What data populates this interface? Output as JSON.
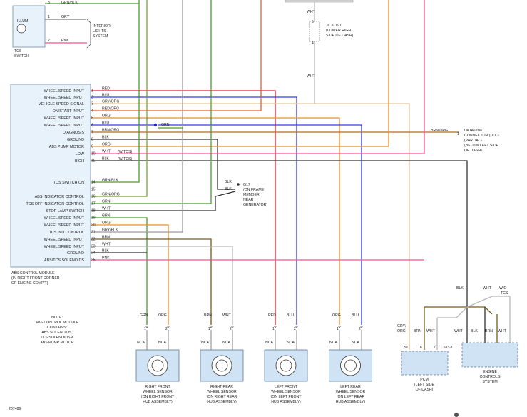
{
  "tcs_switch": {
    "illum": "ILLUM",
    "name": [
      "TCS",
      "SWITCH"
    ],
    "pins": [
      "1",
      "2"
    ],
    "wires": [
      "GRY",
      "PNK"
    ],
    "top_wire": "GRN/BLK",
    "top_pin": "3"
  },
  "interior_lights": [
    "INTERIOR",
    "LIGHTS",
    "SYSTEM"
  ],
  "jc191": {
    "wire_top": "WHT",
    "wire_bottom": "WHT",
    "label": [
      "J/C C191",
      "(LOWER RIGHT",
      "SIDE OF DASH)"
    ],
    "pins": [
      "5",
      "4"
    ]
  },
  "abs_module": {
    "title": [
      "ABS CONTROL MODULE",
      "(IN RIGHT FRONT CORNER",
      "OF ENGINE COMP'T)"
    ],
    "pins": [
      {
        "num": "1",
        "label": "WHEEL SPEED INPUT",
        "wire": "RED"
      },
      {
        "num": "2",
        "label": "WHEEL SPEED INPUT",
        "wire": "BLU"
      },
      {
        "num": "3",
        "label": "VEHICLE SPEED SIGNAL",
        "wire": "GRY/ORG"
      },
      {
        "num": "4",
        "label": "ON/START INPUT",
        "wire": "RED/ORG"
      },
      {
        "num": "5",
        "label": "WHEEL SPEED INPUT",
        "wire": "ORG"
      },
      {
        "num": "6",
        "label": "WHEEL SPEED INPUT",
        "wire": "BLU"
      },
      {
        "num": "7",
        "label": "DIAGNOSIS",
        "wire": "BRN/ORG"
      },
      {
        "num": "8",
        "label": "GROUND",
        "wire": "BLK"
      },
      {
        "num": "9",
        "label": "ABS PUMP MOTOR",
        "wire": "ORG"
      },
      {
        "num": "10",
        "label": "LOW",
        "wire": "WHT"
      },
      {
        "num": "11",
        "label": "HIGH",
        "wire": "BLK"
      },
      {
        "num": "14",
        "label": "TCS SWITCH ON",
        "wire": "GRN/BLK"
      },
      {
        "num": "15",
        "label": "",
        "wire": ""
      },
      {
        "num": "16",
        "label": "ABS INDICATOR CONTROL",
        "wire": "GRN/ORG"
      },
      {
        "num": "17",
        "label": "TCS OFF INDICATOR CONTROL",
        "wire": "GRN"
      },
      {
        "num": "18",
        "label": "STOP LAMP SWITCH",
        "wire": "WHT"
      },
      {
        "num": "19",
        "label": "WHEEL SPEED INPUT",
        "wire": "GRN"
      },
      {
        "num": "20",
        "label": "WHEEL SPEED INPUT",
        "wire": "ORG"
      },
      {
        "num": "21",
        "label": "TCS IND CONTROL",
        "wire": "GRY/BLK"
      },
      {
        "num": "22",
        "label": "WHEEL SPEED INPUT",
        "wire": "BRN"
      },
      {
        "num": "23",
        "label": "WHEEL SPEED INPUT",
        "wire": "WHT"
      },
      {
        "num": "24",
        "label": "GROUND",
        "wire": "BLK"
      },
      {
        "num": "25",
        "label": "ABS/TCS SOLENOIDS",
        "wire": "PNK"
      }
    ],
    "wtcs": "(W/TCS)"
  },
  "splice_wire": "GRN",
  "dlc": {
    "wire": "BRN/ORG",
    "pin": "1",
    "label": [
      "DATA LINK",
      "CONNECTOR (DLC)",
      "(PARTIAL)",
      "(BELOW LEFT SIDE",
      "OF DASH)"
    ]
  },
  "ground": {
    "wires": [
      "BLK",
      "BLK"
    ],
    "label": [
      "G17",
      "(ON FRAME",
      "MEMBER,",
      "NEAR",
      "GENERATOR)"
    ]
  },
  "note": [
    "NOTE:",
    "ABS CONTROL MODULE",
    "CONTAINS:",
    "ABS SOLENOIDS,",
    "TCS SOLENOIDS &",
    "ABS PUMP MOTOR"
  ],
  "sensors": [
    {
      "wires": [
        "GRN",
        "ORG"
      ],
      "label": [
        "RIGHT FRONT",
        "WHEEL SENSOR",
        "(ON RIGHT FRONT",
        "HUB ASSEMBLY)"
      ]
    },
    {
      "wires": [
        "BRN",
        "WHT"
      ],
      "label": [
        "RIGHT REAR",
        "WHEEL SENSOR",
        "(ON RIGHT REAR",
        "HUB ASSEMBLY)"
      ]
    },
    {
      "wires": [
        "RED",
        "BLU"
      ],
      "label": [
        "LEFT FRONT",
        "WHEEL SENSOR",
        "(ON LEFT FRONT",
        "HUB ASSEMBLY)"
      ]
    },
    {
      "wires": [
        "ORG",
        "BLU"
      ],
      "label": [
        "LEFT REAR",
        "WHEEL SENSOR",
        "(ON LEFT REAR",
        "HUB ASSEMBLY)"
      ]
    }
  ],
  "sensor_pins": [
    "1",
    "2"
  ],
  "nca": "NCA",
  "pcm": {
    "label": [
      "PCM",
      "(LEFT SIDE",
      "OF DASH)"
    ],
    "wire_top": "GRY/",
    "wire_bottom": "ORG",
    "wire_brn": "BRN",
    "wire_wht": "WHT",
    "pins": [
      "39",
      "6",
      "7"
    ],
    "connector": "C183-3"
  },
  "ecs": {
    "label": [
      "ENGINE",
      "CONTROLS",
      "SYSTEM"
    ],
    "wires": [
      "WHT",
      "BLK",
      "BRN",
      "WHT"
    ],
    "top_blk": "BLK",
    "top_wht": "WHT",
    "wo_tcs": [
      "W/O",
      "TCS"
    ]
  },
  "figure_number": "207486",
  "colors": {
    "red": "#e8202a",
    "blue": "#2f3de0",
    "green": "#4a9e2c",
    "orange": "#e8902b",
    "brown": "#7a5a18",
    "black": "#333333",
    "gray": "#b8b8b8",
    "pink": "#ff4f9e",
    "grn_org": "#7fa03a",
    "brn_org": "#b26a1c",
    "gry_org": "#e5c7a0",
    "red_org": "#e85a2a",
    "gry_blk": "#9a9a9a"
  }
}
